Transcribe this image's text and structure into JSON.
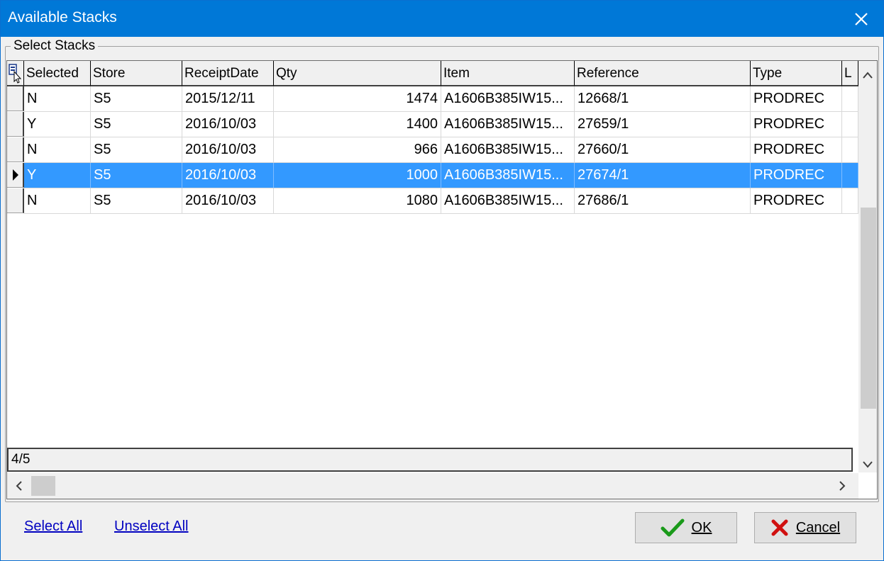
{
  "window": {
    "title": "Available Stacks"
  },
  "group": {
    "label": "Select Stacks"
  },
  "grid": {
    "columns": [
      "Selected",
      "Store",
      "ReceiptDate",
      "Qty",
      "Item",
      "Reference",
      "Type",
      "L"
    ],
    "rows": [
      {
        "selected": "N",
        "store": "S5",
        "receipt_date": "2015/12/11",
        "qty": "1474",
        "item": "A1606B385IW15...",
        "reference": "12668/1",
        "type": "PRODREC"
      },
      {
        "selected": "Y",
        "store": "S5",
        "receipt_date": "2016/10/03",
        "qty": "1400",
        "item": "A1606B385IW15...",
        "reference": "27659/1",
        "type": "PRODREC"
      },
      {
        "selected": "N",
        "store": "S5",
        "receipt_date": "2016/10/03",
        "qty": "966",
        "item": "A1606B385IW15...",
        "reference": "27660/1",
        "type": "PRODREC"
      },
      {
        "selected": "Y",
        "store": "S5",
        "receipt_date": "2016/10/03",
        "qty": "1000",
        "item": "A1606B385IW15...",
        "reference": "27674/1",
        "type": "PRODREC"
      },
      {
        "selected": "N",
        "store": "S5",
        "receipt_date": "2016/10/03",
        "qty": "1080",
        "item": "A1606B385IW15...",
        "reference": "27686/1",
        "type": "PRODREC"
      }
    ],
    "current_row_index": 3,
    "status": "4/5"
  },
  "links": {
    "select_all": "Select All",
    "unselect_all": "Unselect All"
  },
  "buttons": {
    "ok": "OK",
    "cancel": "Cancel"
  },
  "icons": {
    "close": "close-icon",
    "ok": "checkmark-icon",
    "cancel": "x-mark-icon",
    "current_row": "row-pointer-icon",
    "column_chooser": "column-chooser-icon"
  },
  "colors": {
    "titlebar": "#0078d7",
    "selection": "#3399ff",
    "ok_check": "#1a9a1a",
    "cancel_x": "#d01010",
    "link": "#0000c0"
  }
}
